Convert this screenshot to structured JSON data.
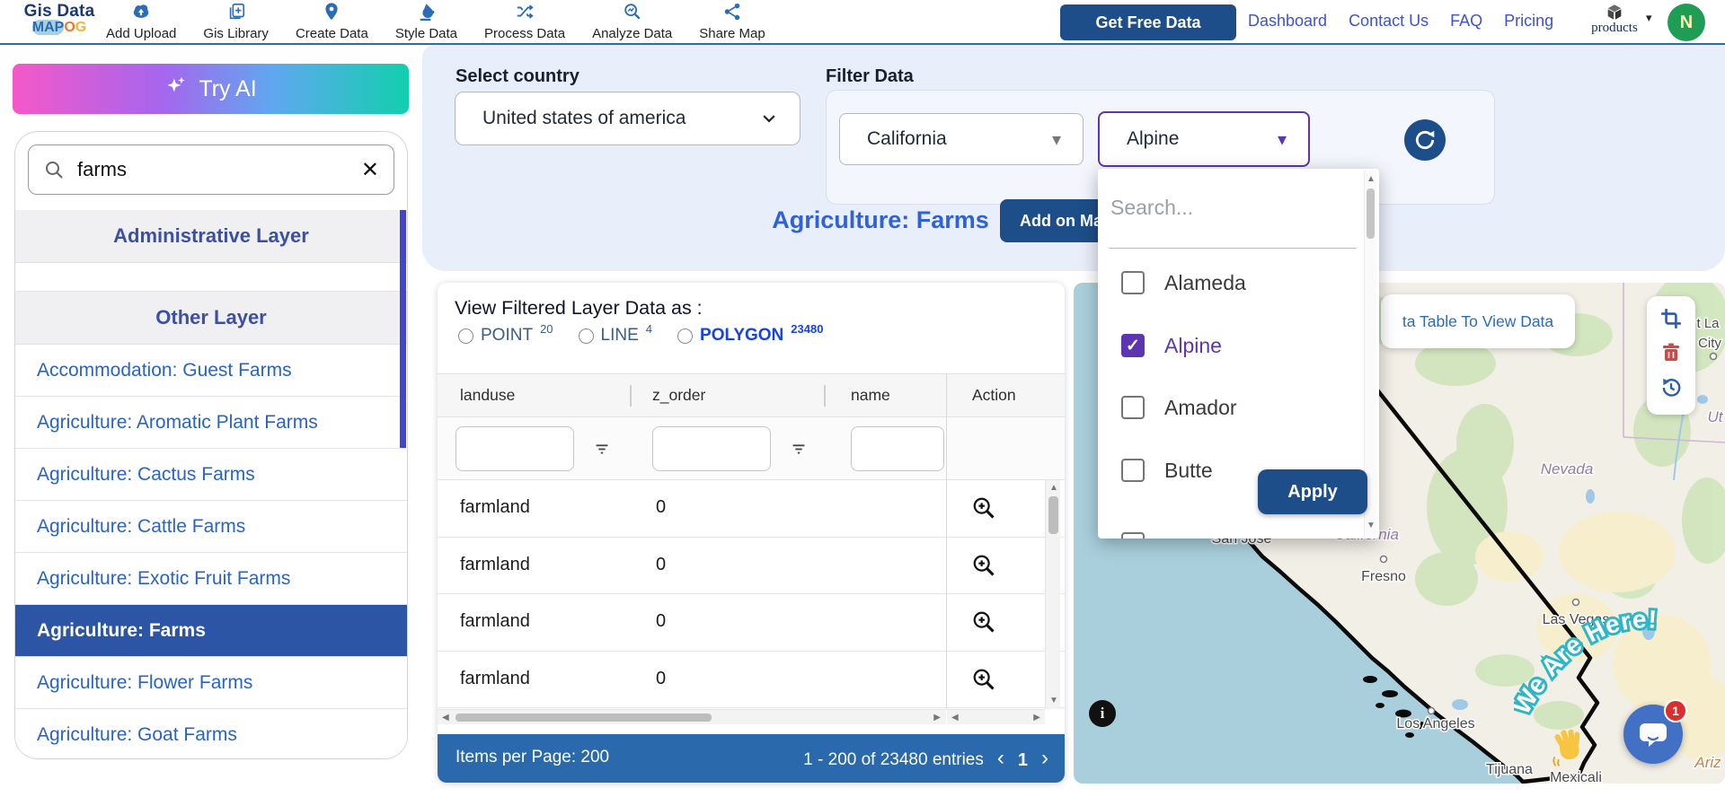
{
  "topbar": {
    "logo": {
      "line1": "Gis Data",
      "map": "MAP",
      "o": "O",
      "g": "G"
    },
    "nav": [
      "Add Upload",
      "Gis Library",
      "Create Data",
      "Style Data",
      "Process Data",
      "Analyze Data",
      "Share Map"
    ],
    "get_free_data": "Get Free Data",
    "links": [
      "Dashboard",
      "Contact Us",
      "FAQ",
      "Pricing"
    ],
    "products_label": "products",
    "avatar_initial": "N"
  },
  "sidebar": {
    "try_ai": "Try AI",
    "search_value": "farms",
    "section_admin": "Administrative Layer",
    "section_other": "Other Layer",
    "items": [
      "Accommodation: Guest Farms",
      "Agriculture: Aromatic Plant Farms",
      "Agriculture: Cactus Farms",
      "Agriculture: Cattle Farms",
      "Agriculture: Exotic Fruit Farms",
      "Agriculture: Farms",
      "Agriculture: Flower Farms",
      "Agriculture: Goat Farms"
    ]
  },
  "filter_bar": {
    "select_country_label": "Select country",
    "country_value": "United states of america",
    "filter_data_label": "Filter Data",
    "state_value": "California",
    "county_value": "Alpine",
    "layer_title": "Agriculture: Farms",
    "add_on_label": "Add on Map"
  },
  "county_dropdown": {
    "search_placeholder": "Search...",
    "options": [
      {
        "label": "Alameda",
        "checked": false
      },
      {
        "label": "Alpine",
        "checked": true
      },
      {
        "label": "Amador",
        "checked": false
      },
      {
        "label": "Butte",
        "checked": false
      }
    ],
    "apply_label": "Apply"
  },
  "table": {
    "view_as_label": "View Filtered Layer Data as :",
    "radios": [
      {
        "label": "POINT",
        "count": "20"
      },
      {
        "label": "LINE",
        "count": "4"
      },
      {
        "label": "POLYGON",
        "count": "23480"
      }
    ],
    "columns": [
      "landuse",
      "z_order",
      "name",
      "Action"
    ],
    "rows": [
      {
        "landuse": "farmland",
        "z_order": "0"
      },
      {
        "landuse": "farmland",
        "z_order": "0"
      },
      {
        "landuse": "farmland",
        "z_order": "0"
      },
      {
        "landuse": "farmland",
        "z_order": "0"
      }
    ],
    "pagination": {
      "items_per_page": "Items per Page: 200",
      "range": "1 - 200 of 23480 entries",
      "page": "1",
      "prev": "‹",
      "next": "›"
    }
  },
  "map": {
    "tooltip": "ta Table To View Data",
    "we_are_here": "We Are Here!",
    "chat_badge": "1",
    "labels": {
      "nevada": "Nevada",
      "california": "California",
      "san_jose": "San Jose",
      "fresno": "Fresno",
      "las_vegas": "Las Vegas",
      "los_angeles": "Los Angeles",
      "tijuana": "Tijuana",
      "mexicali": "Mexicali",
      "utah": "Ut",
      "salt_lake_1": "t La",
      "salt_lake_2": "City",
      "arizona": "Ariz"
    }
  },
  "icons": {
    "close": "✕",
    "caret_down": "▾",
    "scroll_up": "▲",
    "scroll_down": "▼",
    "scroll_left": "◀",
    "scroll_right": "▶",
    "check": "✓",
    "info": "i"
  },
  "colors": {
    "accent_blue": "#1d4e89",
    "purple": "#5e35b1",
    "pagination_blue": "#2a69ac",
    "selected_row": "#2d55a5",
    "link_blue": "#3d52d5",
    "ocean": "#a9cfdc"
  }
}
